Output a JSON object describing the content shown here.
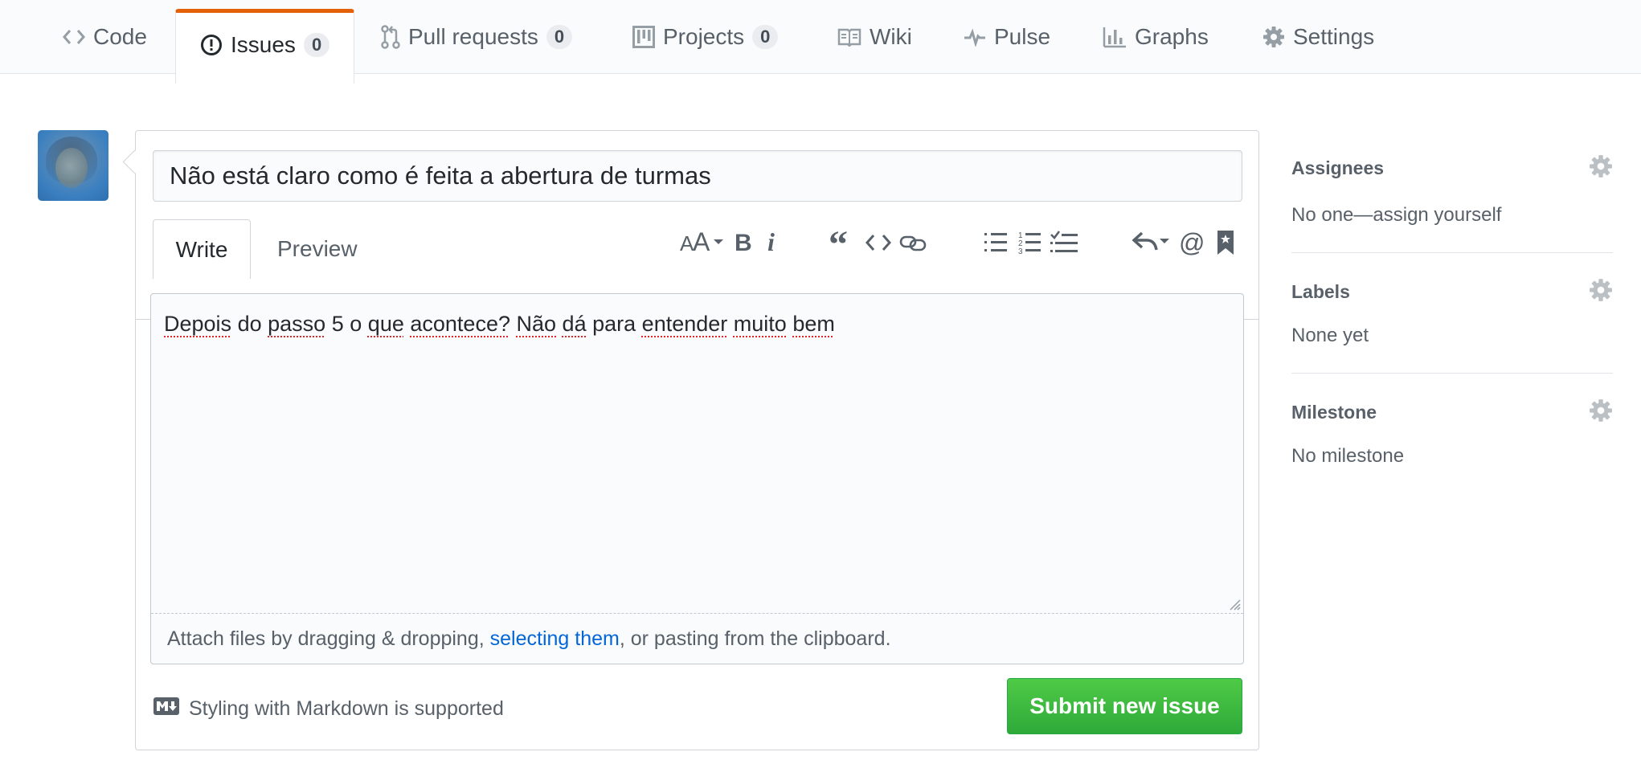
{
  "nav": {
    "tabs": [
      {
        "label": "Code",
        "icon": "code-icon"
      },
      {
        "label": "Issues",
        "count": "0",
        "icon": "issue-opened-icon",
        "selected": true
      },
      {
        "label": "Pull requests",
        "count": "0",
        "icon": "git-pull-request-icon"
      },
      {
        "label": "Projects",
        "count": "0",
        "icon": "project-icon"
      },
      {
        "label": "Wiki",
        "icon": "book-icon"
      },
      {
        "label": "Pulse",
        "icon": "pulse-icon"
      },
      {
        "label": "Graphs",
        "icon": "graph-icon"
      },
      {
        "label": "Settings",
        "icon": "gear-icon"
      }
    ],
    "selected_color": "#e36209"
  },
  "issue": {
    "title_value": "Não está claro como é feita a abertura de turmas",
    "tabs": {
      "write": "Write",
      "preview": "Preview"
    },
    "body_words": [
      "Depois",
      "do",
      "passo",
      "5",
      "o",
      "que",
      "acontece?",
      "Não",
      "dá",
      "para",
      "entender",
      "muito",
      "bem"
    ],
    "attach": {
      "before": "Attach files by dragging & dropping, ",
      "link": "selecting them",
      "after": ", or pasting from the clipboard."
    },
    "markdown_note": "Styling with Markdown is supported",
    "submit_label": "Submit new issue",
    "submit_color": "#2eaa3a",
    "toolbar_icons": [
      "text-size-icon",
      "bold-icon",
      "italic-icon",
      "quote-icon",
      "code-icon",
      "link-icon",
      "unordered-list-icon",
      "ordered-list-icon",
      "task-list-icon",
      "reply-icon",
      "mention-icon",
      "bookmark-icon"
    ]
  },
  "sidebar": {
    "assignees": {
      "heading": "Assignees",
      "value": "No one—assign yourself"
    },
    "labels": {
      "heading": "Labels",
      "value": "None yet"
    },
    "milestone": {
      "heading": "Milestone",
      "value": "No milestone"
    }
  }
}
